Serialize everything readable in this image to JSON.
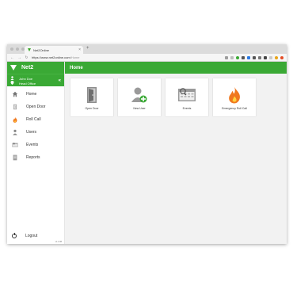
{
  "browser": {
    "tab_title": "Net2Online",
    "tab_close": "×",
    "new_tab": "+",
    "url_host": "https://www.net2online.com",
    "url_path": "/Home",
    "nav": {
      "back": "←",
      "forward": "→",
      "reload": "↻"
    }
  },
  "app": {
    "brand_name": "Net2",
    "user": {
      "name": "John Doe",
      "site": "Head Office",
      "collapse": "«"
    },
    "page_title": "Home",
    "sidebar": {
      "items": [
        {
          "label": "Home",
          "icon": "home-icon"
        },
        {
          "label": "Open Door",
          "icon": "door-icon"
        },
        {
          "label": "Roll Call",
          "icon": "flame-icon"
        },
        {
          "label": "Users",
          "icon": "user-icon"
        },
        {
          "label": "Events",
          "icon": "events-icon"
        },
        {
          "label": "Reports",
          "icon": "report-icon"
        }
      ],
      "logout": "Logout",
      "version": "v1.1.88"
    },
    "tiles": [
      {
        "label": "Open Door",
        "icon": "door-icon"
      },
      {
        "label": "New User",
        "icon": "add-user-icon"
      },
      {
        "label": "Events",
        "icon": "events-icon"
      },
      {
        "label": "Emergency Roll Call",
        "icon": "flame-icon"
      }
    ],
    "colors": {
      "brand_green": "#3aa935",
      "flame_orange": "#f0781e"
    }
  }
}
